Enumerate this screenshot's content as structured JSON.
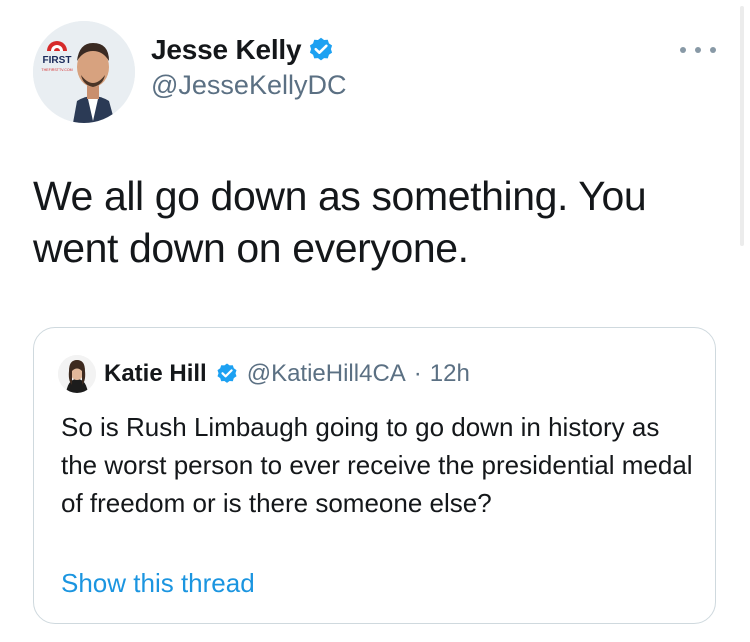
{
  "author": {
    "name": "Jesse Kelly",
    "handle": "@JesseKellyDC",
    "logo_text": "FIRST",
    "logo_subtext": "THEFIRSTTV.COM"
  },
  "tweet": {
    "text": "We all go down as something. You went down on everyone."
  },
  "quoted": {
    "name": "Katie Hill",
    "handle": "@KatieHill4CA",
    "separator": "·",
    "time": "12h",
    "text": "So is Rush Limbaugh going to go down in history as the worst person to ever receive the presidential medal of freedom or is there someone else?",
    "link": "Show this thread"
  },
  "colors": {
    "verified": "#1da1f2",
    "link": "#1b95e0",
    "secondary_text": "#5b7083",
    "border": "#cfd9de",
    "logo_red": "#d62a2a"
  },
  "icons": {
    "verified": "verified-badge-icon",
    "more": "more-options-icon"
  }
}
